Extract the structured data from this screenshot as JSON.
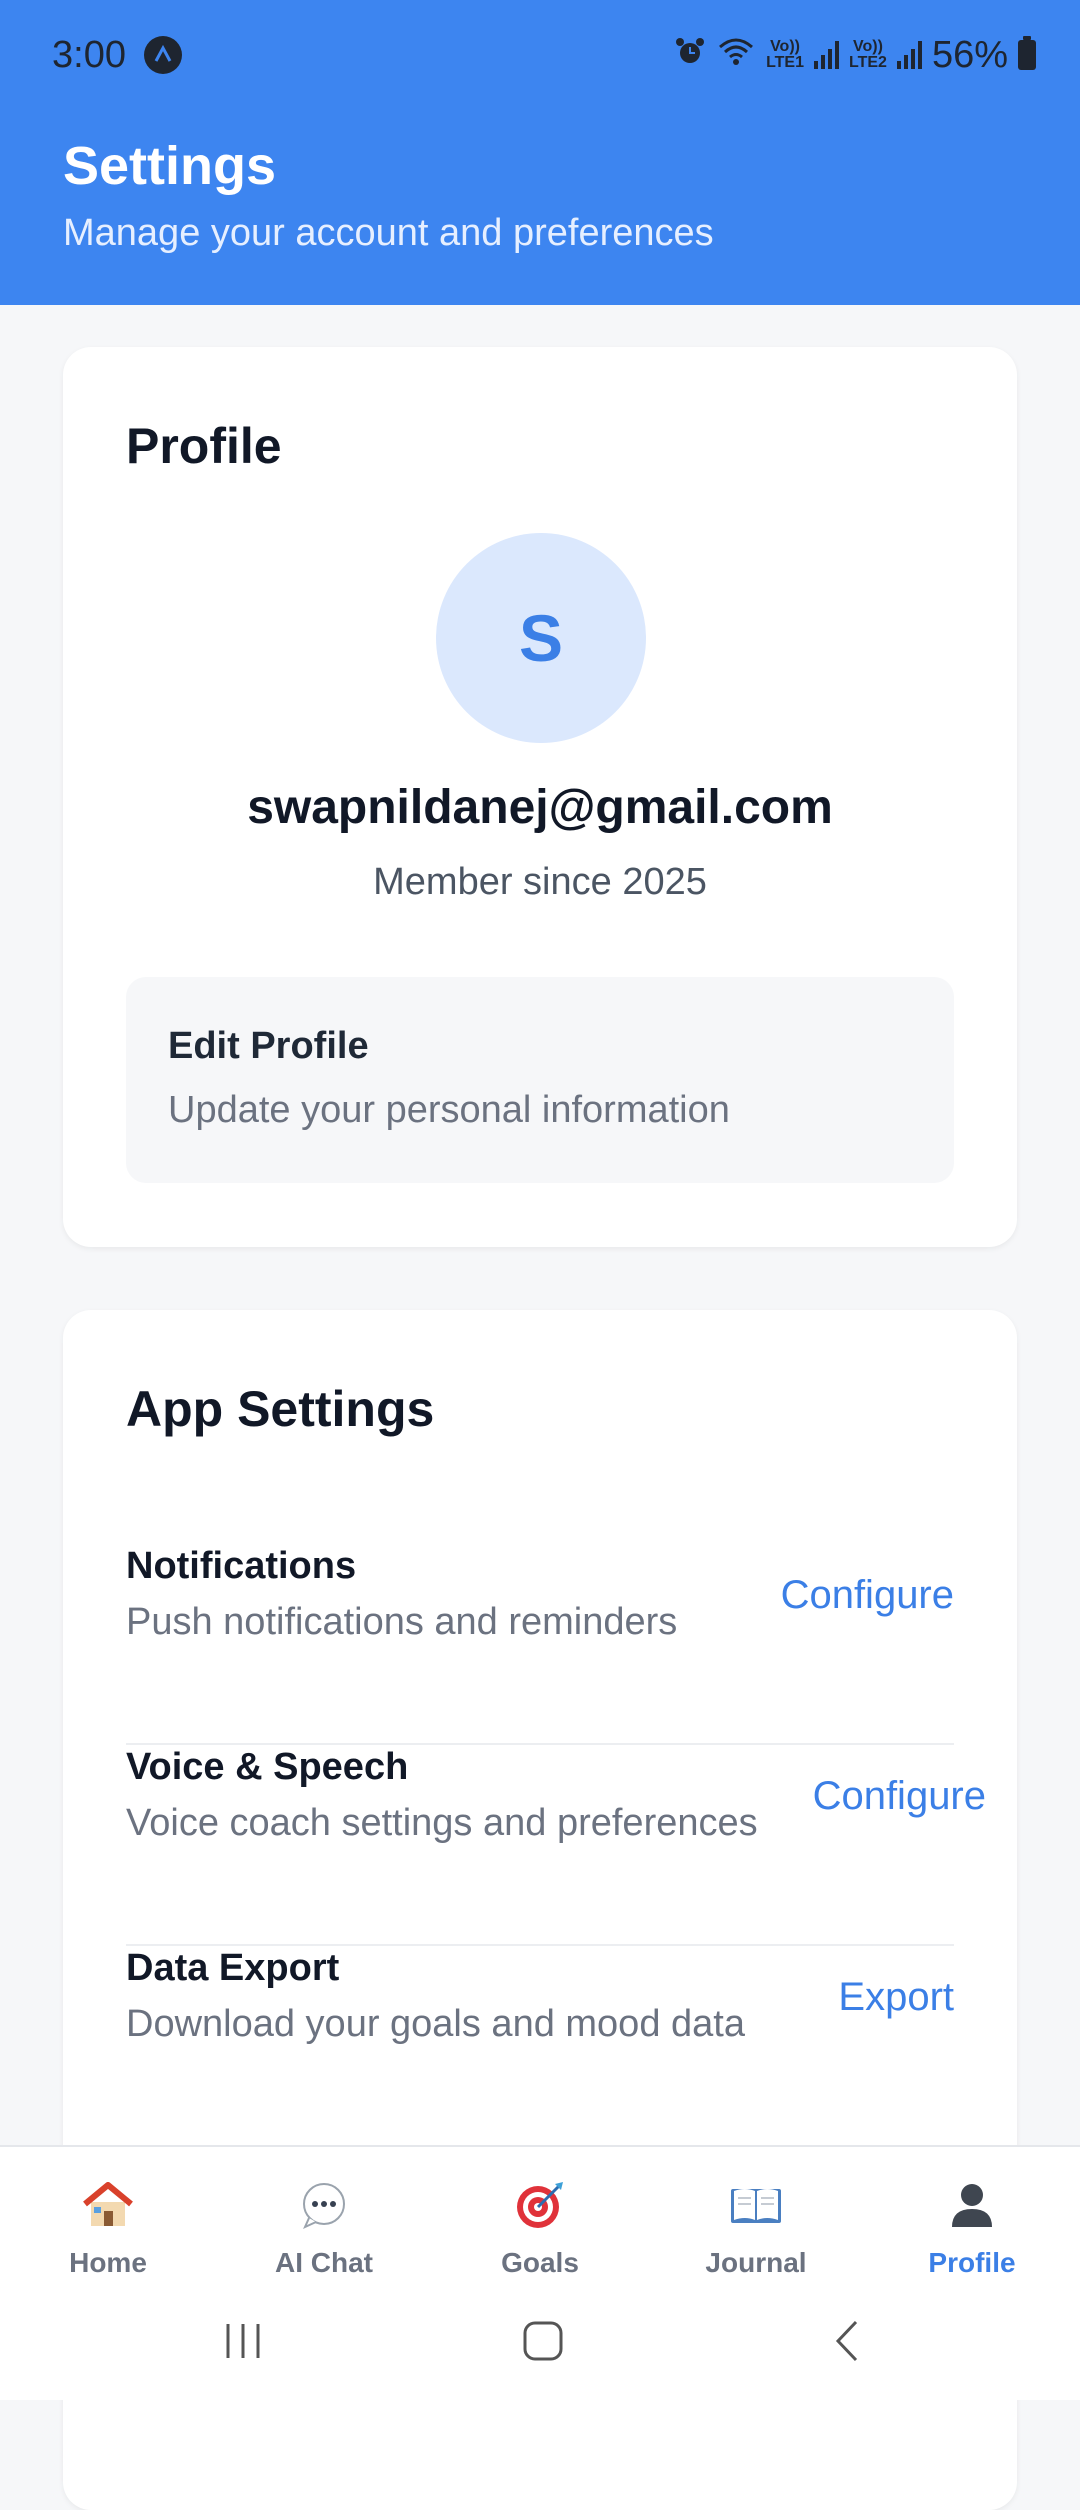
{
  "status_bar": {
    "time": "3:00",
    "battery": "56%",
    "sim1_label_top": "Vo))",
    "sim1_label_bottom": "LTE1",
    "sim2_label_top": "Vo))",
    "sim2_label_bottom": "LTE2"
  },
  "header": {
    "title": "Settings",
    "subtitle": "Manage your account and preferences"
  },
  "profile": {
    "section_title": "Profile",
    "avatar_initial": "S",
    "email": "swapnildanej@gmail.com",
    "member_since": "Member since 2025",
    "edit": {
      "title": "Edit Profile",
      "subtitle": "Update your personal information"
    }
  },
  "app_settings": {
    "section_title": "App Settings",
    "rows": [
      {
        "title": "Notifications",
        "subtitle": "Push notifications and reminders",
        "action": "Configure"
      },
      {
        "title": "Voice & Speech",
        "subtitle": "Voice coach settings and preferences",
        "action": "Configure"
      },
      {
        "title": "Data Export",
        "subtitle": "Download your goals and mood data",
        "action": "Export"
      }
    ]
  },
  "bottom_nav": {
    "items": [
      {
        "label": "Home",
        "icon": "home-icon"
      },
      {
        "label": "AI Chat",
        "icon": "chat-bubble-icon"
      },
      {
        "label": "Goals",
        "icon": "target-icon"
      },
      {
        "label": "Journal",
        "icon": "open-book-icon"
      },
      {
        "label": "Profile",
        "icon": "person-icon"
      }
    ],
    "active": "Profile"
  },
  "colors": {
    "header_bg": "#3d85f0",
    "accent": "#3b7fe6",
    "avatar_bg": "#dbe8fd",
    "page_bg": "#f6f7f9"
  }
}
